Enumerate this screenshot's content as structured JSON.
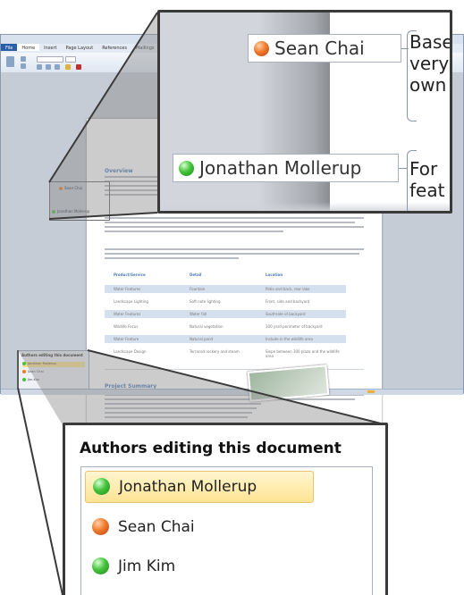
{
  "word_window": {
    "tabs": [
      "File",
      "Home",
      "Insert",
      "Page Layout",
      "References",
      "Mailings"
    ],
    "page": {
      "heading_overview": "Overview",
      "heading_summary": "Project Summary",
      "table_headers": [
        "Product/Service",
        "Detail",
        "Location"
      ],
      "table_rows": [
        [
          "Water Features",
          "Fountain",
          "Patio and back, rear lake"
        ],
        [
          "Landscape Lighting",
          "Soft note lighting",
          "Front, side and backyard"
        ],
        [
          "Water Features",
          "Water fall",
          "Southside of backyard"
        ],
        [
          "Wildlife Focus",
          "Natural vegetation",
          "100 yard perimeter of backyard"
        ],
        [
          "Water Feature",
          "Natural pond",
          "Include in the wildlife area"
        ],
        [
          "Landscape Design",
          "Terraced rockery and steam",
          "Slope between 300 plaza and the wildlife area"
        ]
      ]
    },
    "mini_authors": {
      "title": "Authors editing this document",
      "names": [
        "Jonathan Mollerup",
        "Sean Chai",
        "Jim Kim"
      ]
    }
  },
  "top_callout": {
    "tags": [
      {
        "name": "Sean Chai",
        "status_color": "#f07b2c",
        "icon": "orange-presence-icon"
      },
      {
        "name": "Jonathan Mollerup",
        "status_color": "#45c33c",
        "icon": "green-presence-icon"
      }
    ],
    "para_sean": "Base\nvery\nown",
    "para_jon": "For\nfeat"
  },
  "authors_panel": {
    "title": "Authors editing this document",
    "authors": [
      {
        "name": "Jonathan Mollerup",
        "status_color": "#45c33c",
        "icon": "green-presence-icon",
        "selected": true
      },
      {
        "name": "Sean Chai",
        "status_color": "#f07b2c",
        "icon": "orange-presence-icon",
        "selected": false
      },
      {
        "name": "Jim Kim",
        "status_color": "#45c33c",
        "icon": "green-presence-icon",
        "selected": false
      }
    ]
  }
}
